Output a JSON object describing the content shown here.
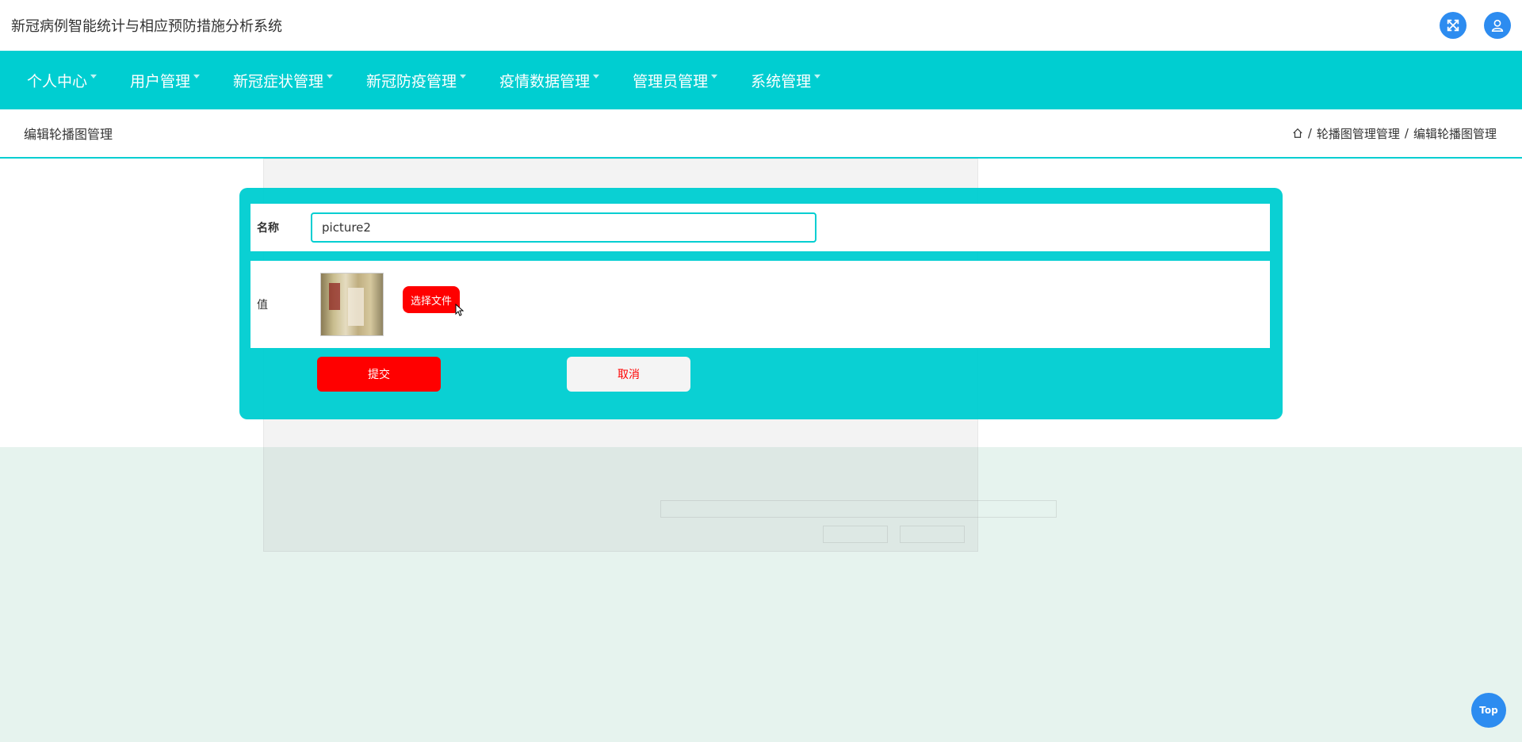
{
  "header": {
    "title": "新冠病例智能统计与相应预防措施分析系统",
    "icons": [
      "fullscreen-icon",
      "user-icon"
    ]
  },
  "nav": {
    "items": [
      {
        "label": "个人中心"
      },
      {
        "label": "用户管理"
      },
      {
        "label": "新冠症状管理"
      },
      {
        "label": "新冠防疫管理"
      },
      {
        "label": "疫情数据管理"
      },
      {
        "label": "管理员管理"
      },
      {
        "label": "系统管理"
      }
    ]
  },
  "crumbbar": {
    "page_title": "编辑轮播图管理",
    "breadcrumb": [
      "轮播图管理管理",
      "编辑轮播图管理"
    ],
    "separator": "/"
  },
  "form": {
    "name_label": "名称",
    "name_value": "picture2",
    "value_label": "值",
    "choose_file_label": "选择文件",
    "submit_label": "提交",
    "cancel_label": "取消"
  },
  "top_button": {
    "label": "Top"
  },
  "colors": {
    "accent": "#00ced1",
    "danger": "#ff0000",
    "blue": "#2d8cf0",
    "page_bg": "#e6f3ee"
  }
}
